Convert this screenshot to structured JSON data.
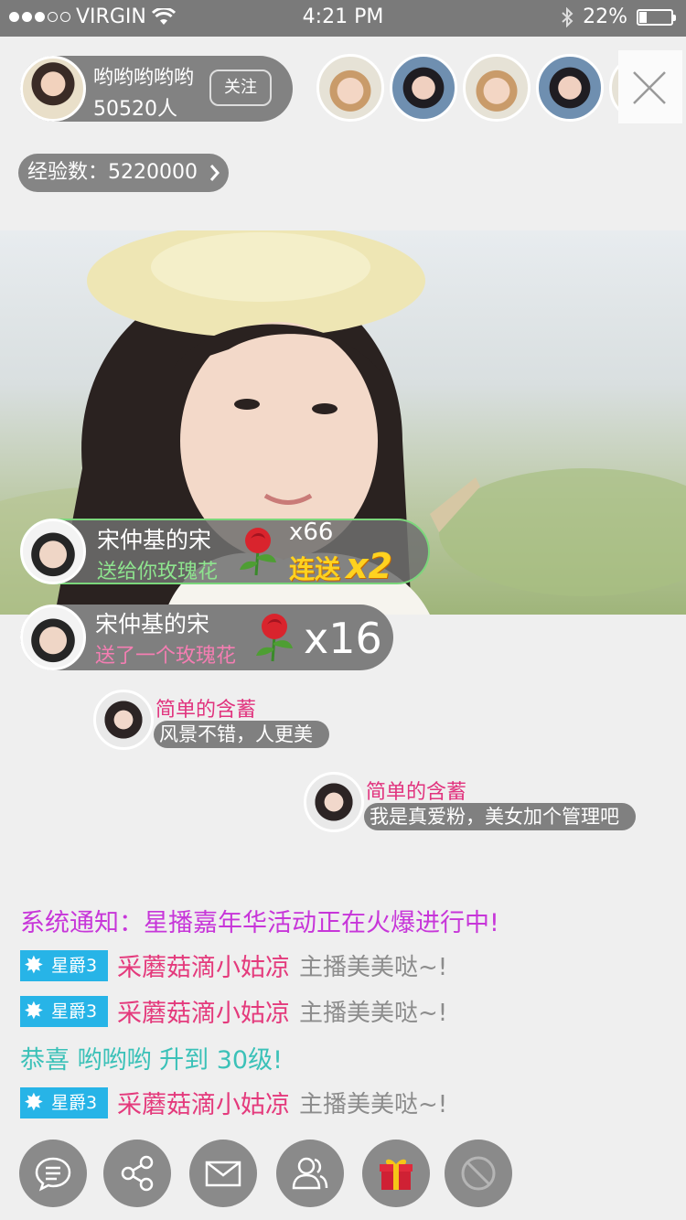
{
  "status_bar": {
    "carrier": "VIRGIN",
    "time": "4:21 PM",
    "battery": "22%",
    "battery_level": 0.22,
    "signal_bars": 3
  },
  "host": {
    "name": "哟哟哟哟哟",
    "audience": "50520人",
    "follow_label": "关注"
  },
  "experience": {
    "label": "经验数：5220000"
  },
  "gifts": [
    {
      "user": "宋仲基的宋",
      "action": "送给你玫瑰花",
      "count": "x66",
      "combo_label": "连送",
      "combo_mult": "x2"
    },
    {
      "user": "宋仲基的宋",
      "action": "送了一个玫瑰花",
      "count": "x16"
    }
  ],
  "chats": [
    {
      "user": "简单的含蓄",
      "text": "风景不错，人更美"
    },
    {
      "user": "简单的含蓄",
      "text": "我是真爱粉，美女加个管理吧"
    }
  ],
  "messages": {
    "system": "系统通知：星播嘉年华活动正在火爆进行中!",
    "congrats": "恭喜 哟哟哟 升到 30级!",
    "badge_label": "星爵3",
    "lines": [
      {
        "user": "采蘑菇滴小姑凉",
        "text": "主播美美哒~!"
      },
      {
        "user": "采蘑菇滴小姑凉",
        "text": "主播美美哒~!"
      },
      {
        "user": "采蘑菇滴小姑凉",
        "text": "主播美美哒~!"
      }
    ]
  },
  "colors": {
    "system": "#c736d9",
    "congrats": "#3bc1b8",
    "username_pink": "#e43a7c",
    "badge": "#27b4e7"
  },
  "icons": [
    "chat-icon",
    "share-icon",
    "mail-icon",
    "users-icon",
    "gift-icon",
    "block-icon"
  ]
}
